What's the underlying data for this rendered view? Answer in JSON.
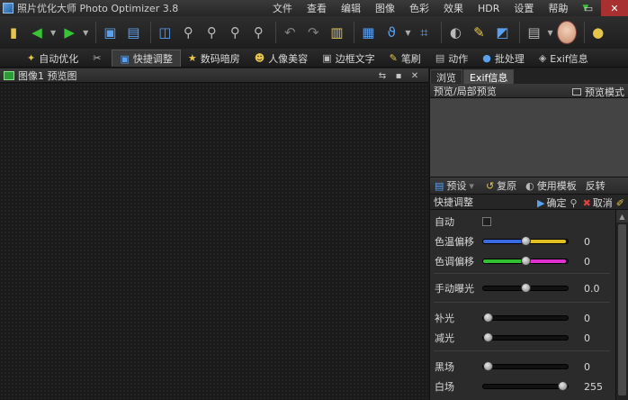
{
  "app": {
    "title": "照片优化大师 Photo Optimizer 3.8"
  },
  "menu": [
    "文件",
    "查看",
    "编辑",
    "图像",
    "色彩",
    "效果",
    "HDR",
    "设置",
    "帮助"
  ],
  "window_buttons": {
    "minimize": "—",
    "maximize": "▭",
    "close": "✕"
  },
  "toolbar_icons": [
    "new-icon",
    "undo-arrow-icon",
    "redo-arrow-icon",
    "save-icon",
    "save-as-icon",
    "compare-icon",
    "zoom-in-icon",
    "zoom-out-icon",
    "zoom-fit-icon",
    "zoom-actual-icon",
    "rotate-left-icon",
    "rotate-right-icon",
    "clipboard-icon",
    "batch-icon",
    "lasso-icon",
    "crop-icon",
    "color-picker-icon",
    "brush-icon",
    "magic-wand-icon",
    "film-icon",
    "portrait-icon",
    "light-bulb-icon"
  ],
  "feature_tabs": [
    {
      "label": "自动优化",
      "icon": "auto-icon",
      "active": false
    },
    {
      "label": "",
      "icon": "tools-icon",
      "active": false
    },
    {
      "label": "快捷调整",
      "icon": "quick-adjust-icon",
      "active": true
    },
    {
      "label": "数码暗房",
      "icon": "star-icon",
      "active": false
    },
    {
      "label": "人像美容",
      "icon": "portrait-icon",
      "active": false
    },
    {
      "label": "边框文字",
      "icon": "frame-icon",
      "active": false
    },
    {
      "label": "笔刷",
      "icon": "brush-icon",
      "active": false
    },
    {
      "label": "动作",
      "icon": "film-icon",
      "active": false
    },
    {
      "label": "批处理",
      "icon": "batch-icon",
      "active": false
    },
    {
      "label": "Exif信息",
      "icon": "camera-icon",
      "active": false
    }
  ],
  "image_panel": {
    "title": "图像1 预览图"
  },
  "right_panel": {
    "tabs": [
      {
        "label": "浏览",
        "active": false
      },
      {
        "label": "Exif信息",
        "active": true
      }
    ],
    "preview": {
      "title": "预览/局部预览",
      "mode_label": "预览模式"
    },
    "preset_bar": {
      "preset": "预设",
      "reset": "复原",
      "template": "使用模板",
      "invert": "反转"
    },
    "quick_adjust": {
      "title": "快捷调整",
      "confirm": "确定",
      "cancel": "取消"
    },
    "controls": {
      "auto_label": "自动",
      "color_temp": {
        "label": "色温偏移",
        "value": "0",
        "level": 0.5,
        "colors": [
          "#3a6ae0",
          "#e0c020"
        ]
      },
      "tint": {
        "label": "色调偏移",
        "value": "0",
        "level": 0.5,
        "colors": [
          "#30c030",
          "#e030d0"
        ]
      },
      "exposure": {
        "label": "手动曝光",
        "value": "0.0",
        "level": 0.5
      },
      "fill_light": {
        "label": "补光",
        "value": "0",
        "level": 0.0
      },
      "reduce_light": {
        "label": "减光",
        "value": "0",
        "level": 0.0
      },
      "black_point": {
        "label": "黑场",
        "value": "0",
        "level": 0.0
      },
      "white_point": {
        "label": "白场",
        "value": "255",
        "level": 1.0
      }
    }
  }
}
